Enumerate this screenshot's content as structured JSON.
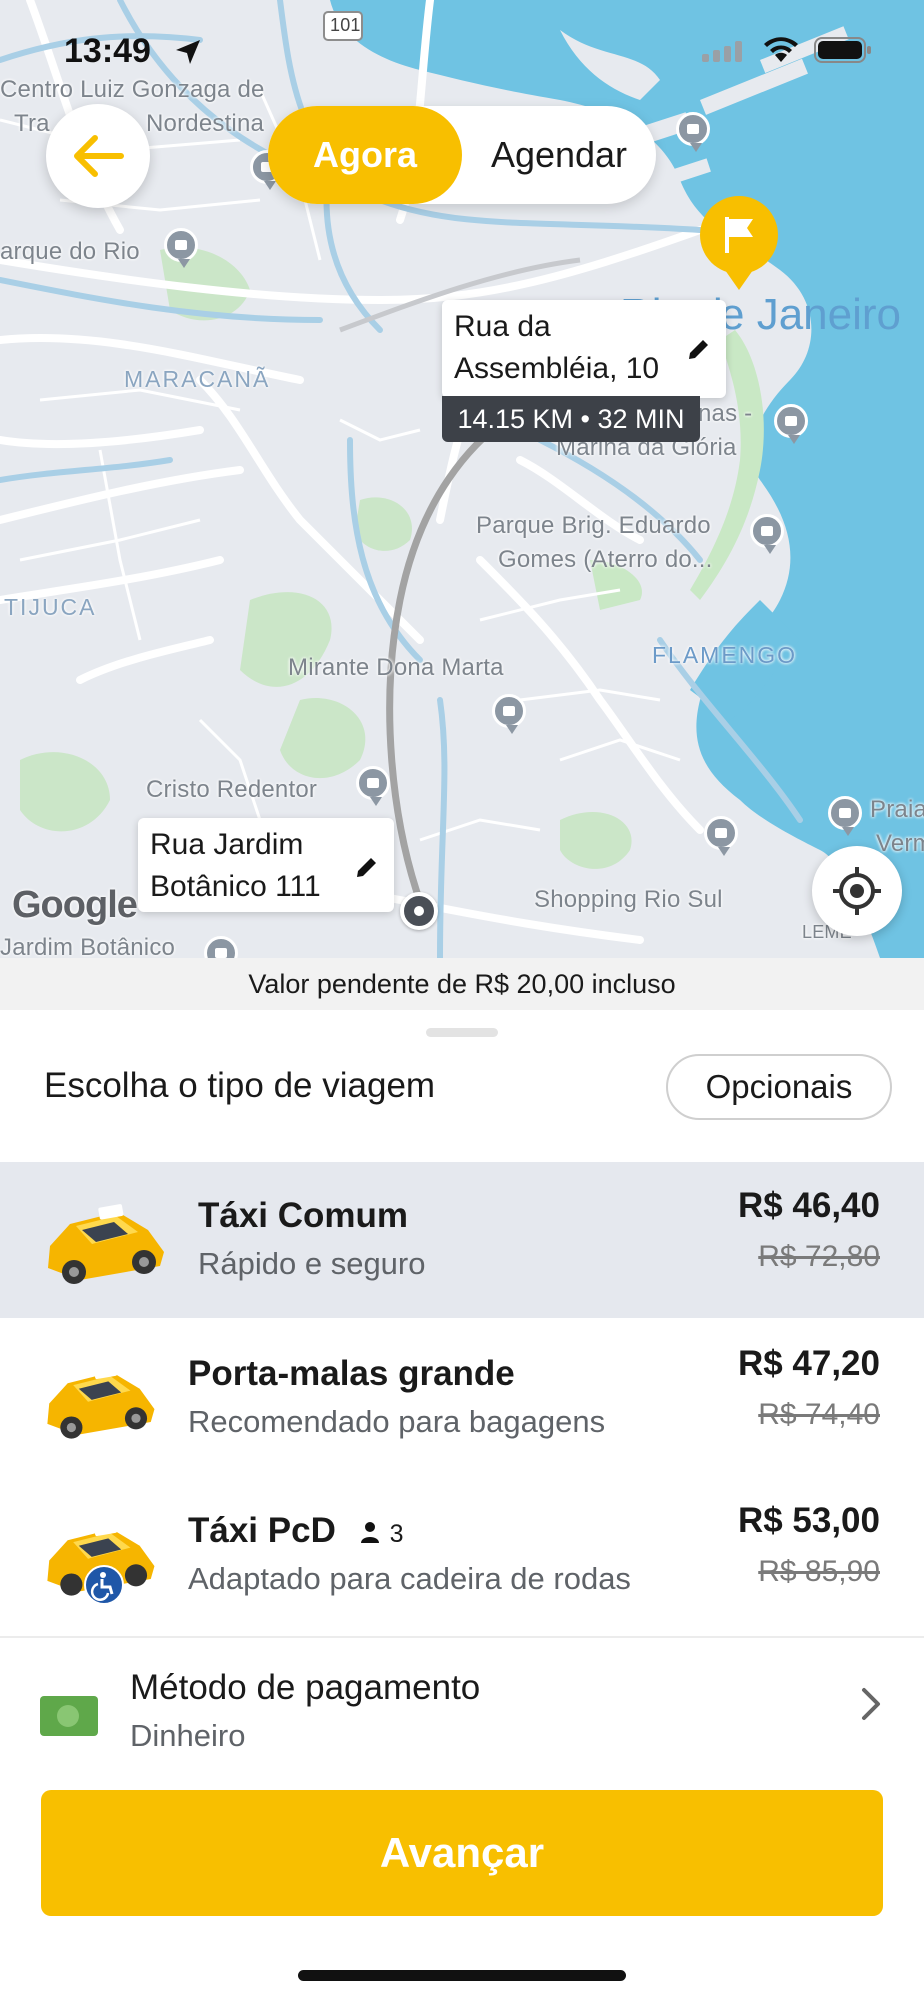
{
  "status_bar": {
    "time": "13:49"
  },
  "map": {
    "road_badge": "101",
    "labels": {
      "centro_luiz": "Centro Luiz Gonzaga de",
      "centro_tra": "Tra",
      "nordestina": "Nordestina",
      "parque_rio": "arque do Rio",
      "maracana": "MARACANÃ",
      "rio_janeiro": "e Janeiro",
      "rio_janeiro_prefix": "Rio d",
      "marina_top": "nas -",
      "marina": "Marina da Glória",
      "parque_brig_1": "Parque Brig. Eduardo",
      "parque_brig_2": "Gomes (Aterro do...",
      "tijuca": "TIJUCA",
      "flamengo": "FLAMENGO",
      "mirante": "Mirante Dona Marta",
      "cristo": "Cristo Redentor",
      "praia_1": "Praia",
      "praia_2": "Verm",
      "shopping": "Shopping Rio Sul",
      "leme": "LEME",
      "jardim": "Jardim Botânico"
    },
    "google_logo": "Google",
    "destination": {
      "address": "Rua da\nAssembléia, 10",
      "eta": "14.15 KM • 32 MIN"
    },
    "origin": {
      "address": "Rua Jardim\nBotânico 111"
    }
  },
  "toggle": {
    "now_label": "Agora",
    "schedule_label": "Agendar"
  },
  "pending_notice": "Valor pendente de R$ 20,00 incluso",
  "trip_selector": {
    "title": "Escolha o tipo de viagem",
    "options_button": "Opcionais",
    "rides": [
      {
        "name": "Táxi Comum",
        "description": "Rápido e seguro",
        "price": "R$ 46,40",
        "original_price": "R$ 72,80",
        "selected": true
      },
      {
        "name": "Porta-malas grande",
        "description": "Recomendado para bagagens",
        "price": "R$ 47,20",
        "original_price": "R$ 74,40",
        "selected": false
      },
      {
        "name": "Táxi PcD",
        "passenger_count": "3",
        "description": "Adaptado para cadeira de rodas",
        "price": "R$ 53,00",
        "original_price": "R$ 85,90",
        "selected": false
      }
    ]
  },
  "payment": {
    "title": "Método de pagamento",
    "method": "Dinheiro"
  },
  "advance_button": "Avançar",
  "colors": {
    "accent": "#f8bf00",
    "selected_row": "#e5e8ee",
    "water": "#6fc3e3"
  }
}
